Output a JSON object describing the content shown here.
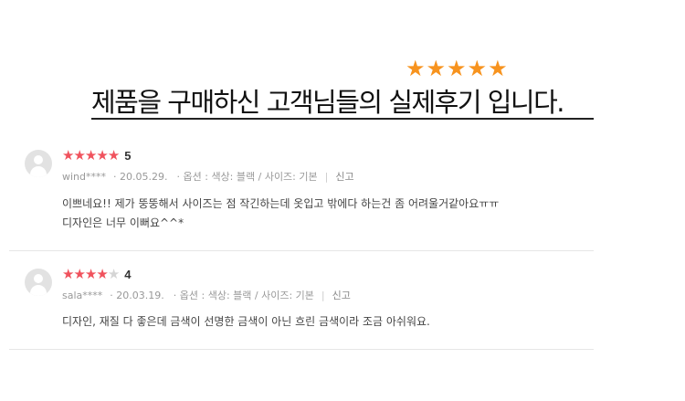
{
  "hero": {
    "stars": 5,
    "title": "제품을 구매하신 고객님들의 실제후기 입니다."
  },
  "colors": {
    "hero_star": "#f7931e",
    "rating_star": "#f0525d",
    "empty_star": "#d5d5d5"
  },
  "reviews": [
    {
      "rating": 5,
      "score": "5",
      "user": "wind****",
      "date": "20.05.29.",
      "options": "옵션 : 색상: 블랙 / 사이즈: 기본",
      "report": "신고",
      "lines": [
        "이쁘네요!! 제가 뚱뚱해서 사이즈는 점 작긴하는데 옷입고 밖에다 하는건 좀 어려울거같아요ㅠㅠ",
        "디자인은 너무 이뻐요^^*"
      ]
    },
    {
      "rating": 4,
      "score": "4",
      "user": "sala****",
      "date": "20.03.19.",
      "options": "옵션 : 색상: 블랙 / 사이즈: 기본",
      "report": "신고",
      "lines": [
        "디자인, 재질 다 좋은데 금색이 선명한 금색이 아닌 흐린 금색이라 조금 아쉬워요."
      ]
    }
  ]
}
